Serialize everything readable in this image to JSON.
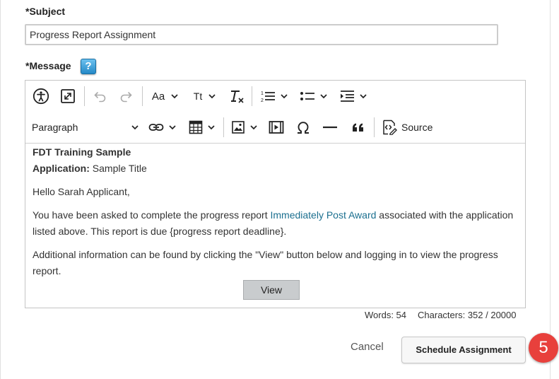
{
  "form": {
    "subject_label": "*Subject",
    "subject_value": "Progress Report Assignment",
    "message_label": "*Message",
    "help_button": "?"
  },
  "toolbar": {
    "icons": [
      "accessibility-icon",
      "maximize-icon",
      "undo-icon",
      "redo-icon",
      "font-family-icon",
      "font-size-icon",
      "remove-format-icon",
      "numbered-list-icon",
      "bulleted-list-icon",
      "indent-icon",
      "link-icon",
      "table-icon",
      "image-icon",
      "media-icon",
      "special-characters-icon",
      "horizontal-line-icon",
      "blockquote-icon",
      "source-icon"
    ],
    "font_family": "Aa",
    "font_size": "Tt",
    "paragraph_format": "Paragraph",
    "source_label": "Source"
  },
  "message_body": {
    "org_name": "FDT Training Sample",
    "application_label": "Application:",
    "application_value": " Sample Title",
    "greeting": "Hello Sarah Applicant,",
    "p1_before": "You have been asked to complete the progress report ",
    "p1_link": "Immediately Post Award",
    "p1_after": " associated with the application listed above. This report is due {progress report deadline}.",
    "p2": "Additional information can be found by clicking the \"View\" button below and logging in to view the progress report.",
    "view_button": "View"
  },
  "stats": {
    "words": "Words: 54",
    "characters": "Characters: 352 / 20000"
  },
  "actions": {
    "cancel_label": "Cancel",
    "schedule_label": "Schedule Assignment",
    "step_number": "5"
  },
  "colors": {
    "link": "#1b6f8f",
    "step_badge": "#e8403c",
    "help_button": "#2589c7"
  }
}
